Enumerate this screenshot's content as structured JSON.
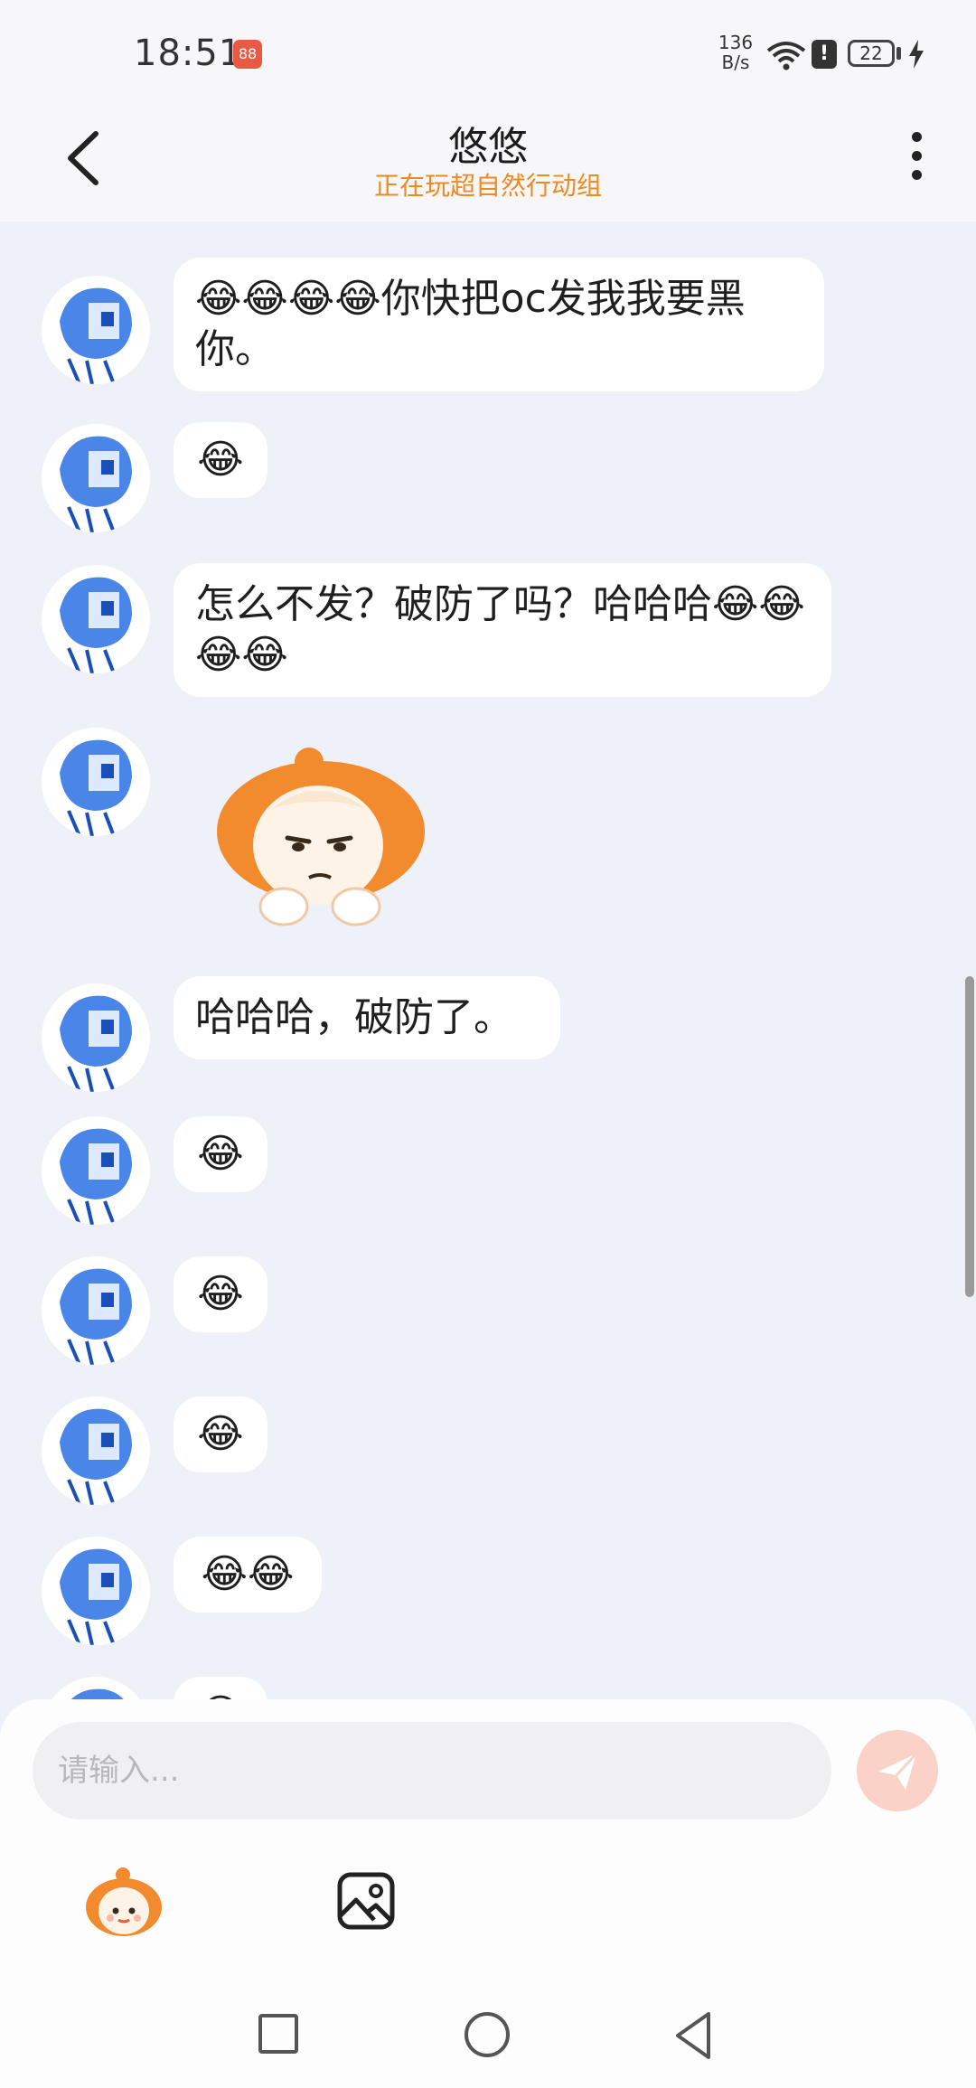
{
  "status_bar": {
    "time": "18:51",
    "app_badge": "88",
    "net_speed_value": "136",
    "net_speed_unit": "B/s",
    "battery": "22"
  },
  "header": {
    "title": "悠悠",
    "subtitle": "正在玩超自然行动组"
  },
  "messages": [
    {
      "type": "text",
      "text": "😂😂😂😂你快把oc发我我要黑你。"
    },
    {
      "type": "text",
      "text": "😂"
    },
    {
      "type": "text",
      "text": "怎么不发？破防了吗？哈哈哈😂😂😂😂"
    },
    {
      "type": "sticker",
      "icon": "smug-orange-hair-girl-sticker"
    },
    {
      "type": "text",
      "text": "哈哈哈，破防了。"
    },
    {
      "type": "text",
      "text": "😂"
    },
    {
      "type": "text",
      "text": "😂"
    },
    {
      "type": "text",
      "text": "😂"
    },
    {
      "type": "text",
      "text": "😂😂"
    },
    {
      "type": "text",
      "text": "😂"
    }
  ],
  "input": {
    "placeholder": "请输入..."
  },
  "colors": {
    "subtitle": "#f08a1e",
    "send_button": "#fbd2c8",
    "chat_background": "#eef1f7",
    "avatar_blue": "#4a86e8"
  }
}
